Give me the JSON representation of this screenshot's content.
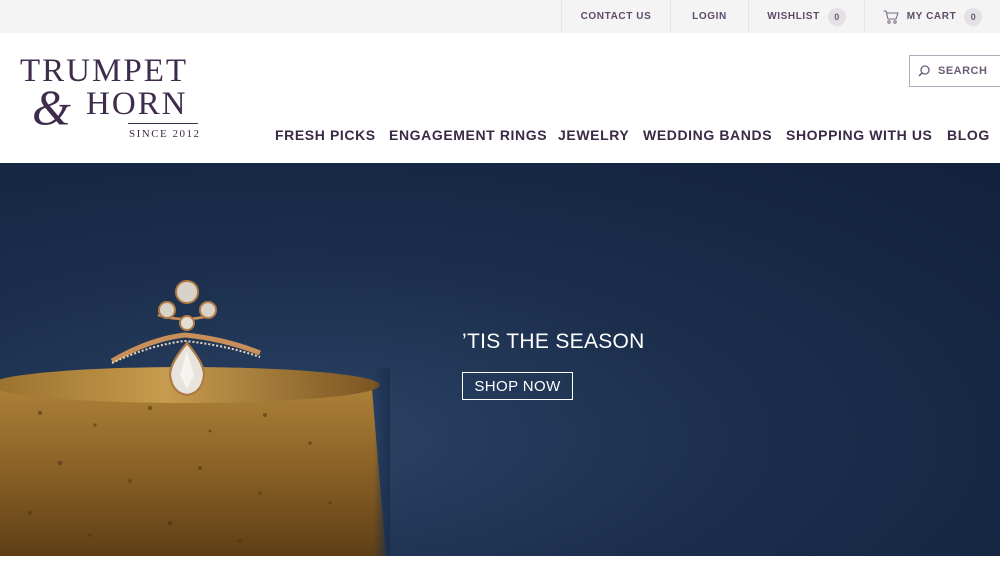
{
  "utility": {
    "contact": "CONTACT US",
    "login": "LOGIN",
    "wishlist": "WISHLIST",
    "wishlist_count": "0",
    "cart": "MY CART",
    "cart_count": "0"
  },
  "logo": {
    "line1": "TRUMPET",
    "ampersand": "&",
    "line2": "HORN",
    "since": "SINCE 2012"
  },
  "search": {
    "label": "SEARCH"
  },
  "nav": {
    "items": [
      "FRESH PICKS",
      "ENGAGEMENT RINGS",
      "JEWELRY",
      "WEDDING BANDS",
      "SHOPPING WITH US",
      "BLOG"
    ]
  },
  "hero": {
    "title": "’TIS THE SEASON",
    "button": "SHOP NOW"
  },
  "colors": {
    "brand": "#3f2c4c",
    "hero_bg": "#1b2e4c",
    "gold": "#b8893b"
  },
  "icons": [
    "cart-icon",
    "search-icon"
  ]
}
